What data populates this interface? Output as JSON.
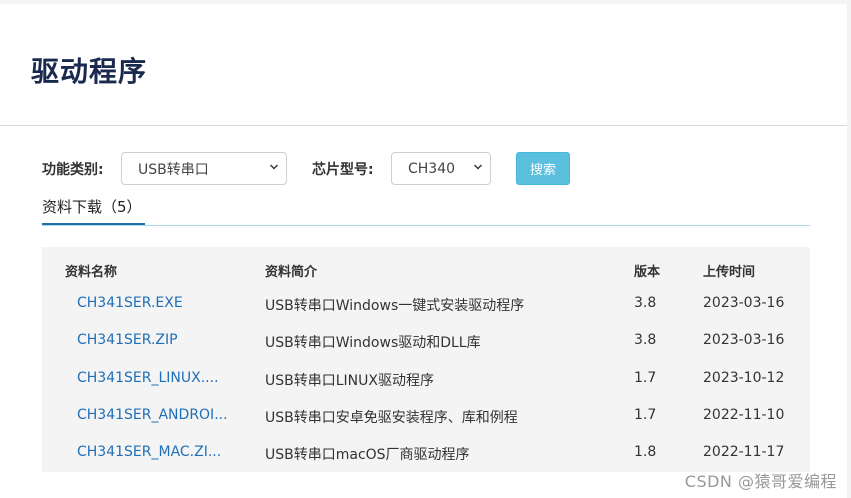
{
  "page_title": "驱动程序",
  "filters": {
    "category_label": "功能类别:",
    "category_value": "USB转串口",
    "chip_label": "芯片型号:",
    "chip_value": "CH340",
    "search_label": "搜索"
  },
  "tab": {
    "label": "资料下载",
    "count": "（5）"
  },
  "table": {
    "headers": [
      "资料名称",
      "资料简介",
      "版本",
      "上传时间"
    ],
    "rows": [
      {
        "name": "CH341SER.EXE",
        "desc": "USB转串口Windows一键式安装驱动程序",
        "version": "3.8",
        "date": "2023-03-16"
      },
      {
        "name": "CH341SER.ZIP",
        "desc": "USB转串口Windows驱动和DLL库",
        "version": "3.8",
        "date": "2023-03-16"
      },
      {
        "name": "CH341SER_LINUX....",
        "desc": "USB转串口LINUX驱动程序",
        "version": "1.7",
        "date": "2023-10-12"
      },
      {
        "name": "CH341SER_ANDROI...",
        "desc": "USB转串口安卓免驱安装程序、库和例程",
        "version": "1.7",
        "date": "2022-11-10"
      },
      {
        "name": "CH341SER_MAC.ZI...",
        "desc": "USB转串口macOS厂商驱动程序",
        "version": "1.8",
        "date": "2022-11-17"
      }
    ]
  },
  "watermark": "CSDN @猿哥爱编程",
  "colors": {
    "title": "#1a2a4f",
    "link": "#1e6fb8",
    "search_button": "#5bc0de",
    "tab_underline": "#1e6fa8"
  }
}
